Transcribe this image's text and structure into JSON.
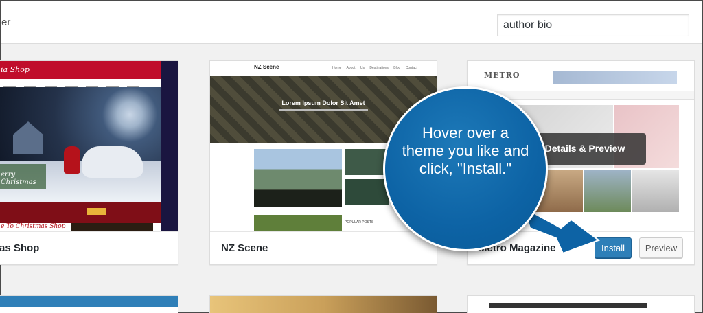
{
  "filter_bar": {
    "partial_label": "er",
    "search_value": "author bio"
  },
  "themes": [
    {
      "name": "as Shop",
      "screenshot": {
        "logo": "ia Shop",
        "banner": "erry Christmas",
        "lower_text": "e To Christmas Shop"
      }
    },
    {
      "name": "NZ Scene",
      "screenshot": {
        "site_title": "NZ Scene",
        "nav": "Home About Us Destinations Blog Contact",
        "headline": "Lorem Ipsum Dolor Sit Amet",
        "popular": "POPULAR POSTS"
      }
    },
    {
      "name": "Metro Magazine",
      "screenshot": {
        "logo": "METRO"
      },
      "overlay_label": "Details & Preview",
      "install_label": "Install",
      "preview_label": "Preview"
    }
  ],
  "callout": {
    "text": "Hover over a theme you like and click, \"Install.\"",
    "color": "#0d63a5"
  },
  "colors": {
    "install_button": "#2e7fb8",
    "background": "#f1f1f1"
  }
}
